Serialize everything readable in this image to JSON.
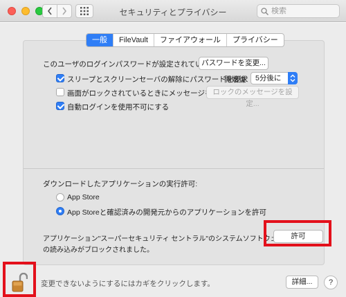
{
  "window": {
    "title": "セキュリティとプライバシー",
    "search": {
      "placeholder": "検索"
    }
  },
  "tabs": [
    {
      "label": "一般",
      "active": true
    },
    {
      "label": "FileVault",
      "active": false
    },
    {
      "label": "ファイアウォール",
      "active": false
    },
    {
      "label": "プライバシー",
      "active": false
    }
  ],
  "general": {
    "password_text": "このユーザのログインパスワードが設定されています",
    "change_password_button": "パスワードを変更...",
    "require_password": {
      "label": "スリープとスクリーンセーバの解除にパスワードを要求",
      "checked": true
    },
    "start_label": "開始後:",
    "start_value": "5分後に",
    "lock_message": {
      "label": "画面がロックされているときにメッセージを表示",
      "checked": false
    },
    "lock_message_button": "ロックのメッセージを設定...",
    "disable_autologin": {
      "label": "自動ログインを使用不可にする",
      "checked": true
    }
  },
  "downloads": {
    "heading": "ダウンロードしたアプリケーションの実行許可:",
    "options": [
      {
        "label": "App Store",
        "selected": false
      },
      {
        "label": "App Storeと確認済みの開発元からのアプリケーションを許可",
        "selected": true
      }
    ],
    "blocked_line1": "アプリケーション\"スーパーセキュリティ セントラル\"のシステムソフトウェア",
    "blocked_line2": "の読み込みがブロックされました。",
    "allow_button": "許可"
  },
  "footer": {
    "lock_text": "変更できないようにするにはカギをクリックします。",
    "advanced_button": "詳細...",
    "help_button": "?"
  },
  "colors": {
    "accent": "#2f7ef6",
    "highlight": "#e3101b"
  }
}
